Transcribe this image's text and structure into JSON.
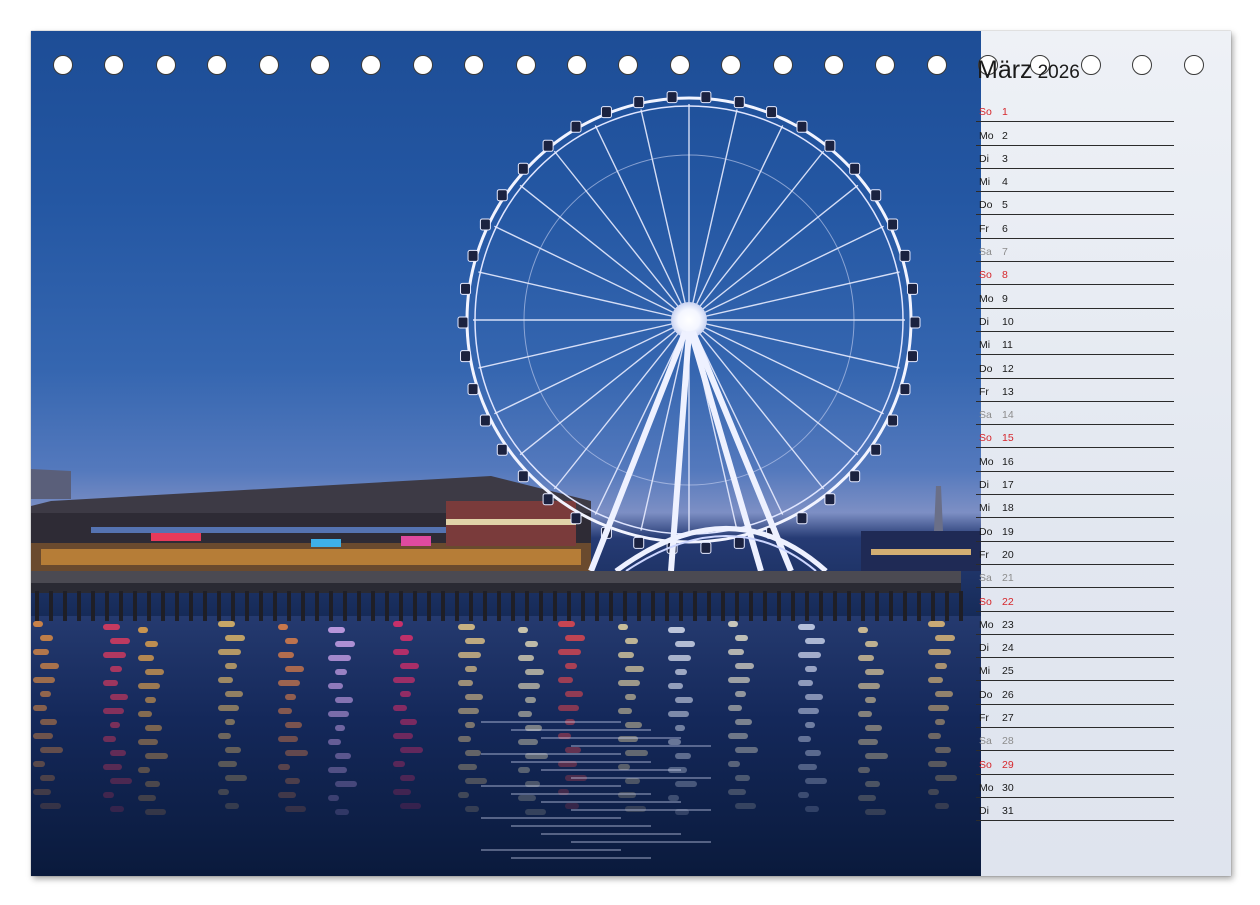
{
  "calendar": {
    "month": "März",
    "year": "2026",
    "days": [
      {
        "wd": "So",
        "d": "1",
        "type": "sun"
      },
      {
        "wd": "Mo",
        "d": "2",
        "type": "wk"
      },
      {
        "wd": "Di",
        "d": "3",
        "type": "wk"
      },
      {
        "wd": "Mi",
        "d": "4",
        "type": "wk"
      },
      {
        "wd": "Do",
        "d": "5",
        "type": "wk"
      },
      {
        "wd": "Fr",
        "d": "6",
        "type": "wk"
      },
      {
        "wd": "Sa",
        "d": "7",
        "type": "sat"
      },
      {
        "wd": "So",
        "d": "8",
        "type": "sun"
      },
      {
        "wd": "Mo",
        "d": "9",
        "type": "wk"
      },
      {
        "wd": "Di",
        "d": "10",
        "type": "wk"
      },
      {
        "wd": "Mi",
        "d": "11",
        "type": "wk"
      },
      {
        "wd": "Do",
        "d": "12",
        "type": "wk"
      },
      {
        "wd": "Fr",
        "d": "13",
        "type": "wk"
      },
      {
        "wd": "Sa",
        "d": "14",
        "type": "sat"
      },
      {
        "wd": "So",
        "d": "15",
        "type": "sun"
      },
      {
        "wd": "Mo",
        "d": "16",
        "type": "wk"
      },
      {
        "wd": "Di",
        "d": "17",
        "type": "wk"
      },
      {
        "wd": "Mi",
        "d": "18",
        "type": "wk"
      },
      {
        "wd": "Do",
        "d": "19",
        "type": "wk"
      },
      {
        "wd": "Fr",
        "d": "20",
        "type": "wk"
      },
      {
        "wd": "Sa",
        "d": "21",
        "type": "sat"
      },
      {
        "wd": "So",
        "d": "22",
        "type": "sun"
      },
      {
        "wd": "Mo",
        "d": "23",
        "type": "wk"
      },
      {
        "wd": "Di",
        "d": "24",
        "type": "wk"
      },
      {
        "wd": "Mi",
        "d": "25",
        "type": "wk"
      },
      {
        "wd": "Do",
        "d": "26",
        "type": "wk"
      },
      {
        "wd": "Fr",
        "d": "27",
        "type": "wk"
      },
      {
        "wd": "Sa",
        "d": "28",
        "type": "sat"
      },
      {
        "wd": "So",
        "d": "29",
        "type": "sun"
      },
      {
        "wd": "Mo",
        "d": "30",
        "type": "wk"
      },
      {
        "wd": "Di",
        "d": "31",
        "type": "wk"
      }
    ]
  },
  "colors": {
    "sunday": "#d6262b",
    "saturday": "#8c8c8c",
    "weekday": "#1a1a1a"
  },
  "photo": {
    "subject": "ferris-wheel-at-pier-dusk"
  }
}
